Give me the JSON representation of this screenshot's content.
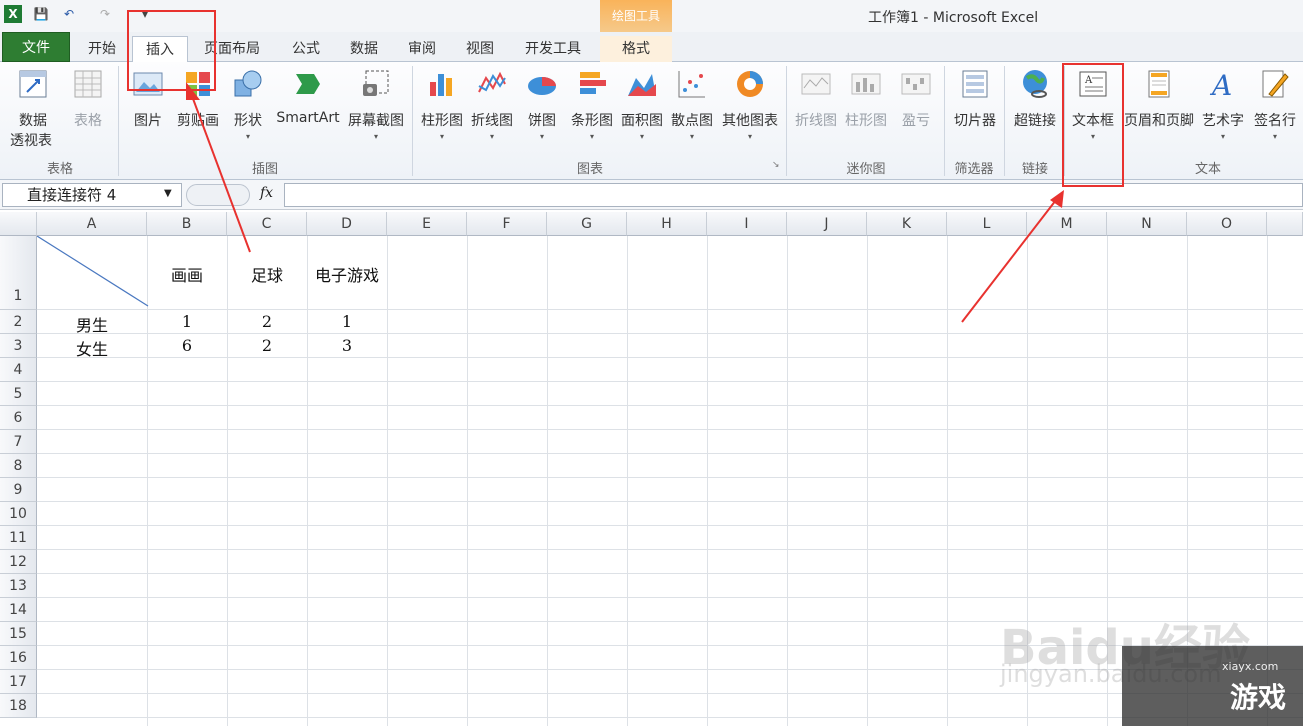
{
  "window": {
    "title": "工作簿1 - Microsoft Excel",
    "context_tab": "绘图工具"
  },
  "tabs": [
    {
      "label": "文件"
    },
    {
      "label": "开始"
    },
    {
      "label": "插入"
    },
    {
      "label": "页面布局"
    },
    {
      "label": "公式"
    },
    {
      "label": "数据"
    },
    {
      "label": "审阅"
    },
    {
      "label": "视图"
    },
    {
      "label": "开发工具"
    },
    {
      "label": "格式"
    }
  ],
  "ribbon": {
    "buttons": [
      {
        "label": "数据",
        "label2": "透视表",
        "icon": "pivot-table-icon"
      },
      {
        "label": "表格",
        "icon": "table-icon"
      },
      {
        "label": "图片",
        "icon": "picture-icon"
      },
      {
        "label": "剪贴画",
        "icon": "clipart-icon"
      },
      {
        "label": "形状",
        "icon": "shapes-icon"
      },
      {
        "label": "SmartArt",
        "icon": "smartart-icon"
      },
      {
        "label": "屏幕截图",
        "icon": "screenshot-icon"
      },
      {
        "label": "柱形图",
        "icon": "column-chart-icon"
      },
      {
        "label": "折线图",
        "icon": "line-chart-icon"
      },
      {
        "label": "饼图",
        "icon": "pie-chart-icon"
      },
      {
        "label": "条形图",
        "icon": "bar-chart-icon"
      },
      {
        "label": "面积图",
        "icon": "area-chart-icon"
      },
      {
        "label": "散点图",
        "icon": "scatter-chart-icon"
      },
      {
        "label": "其他图表",
        "icon": "other-charts-icon"
      },
      {
        "label": "折线图",
        "icon": "sparkline-line-icon"
      },
      {
        "label": "柱形图",
        "icon": "sparkline-column-icon"
      },
      {
        "label": "盈亏",
        "icon": "sparkline-winloss-icon"
      },
      {
        "label": "切片器",
        "icon": "slicer-icon"
      },
      {
        "label": "超链接",
        "icon": "hyperlink-icon"
      },
      {
        "label": "文本框",
        "icon": "textbox-icon"
      },
      {
        "label": "页眉和页脚",
        "icon": "header-footer-icon"
      },
      {
        "label": "艺术字",
        "icon": "wordart-icon"
      },
      {
        "label": "签名行",
        "icon": "signature-icon"
      }
    ],
    "groups": [
      "表格",
      "插图",
      "图表",
      "迷你图",
      "筛选器",
      "链接",
      "文本"
    ]
  },
  "formula_bar": {
    "name_box": "直接连接符 4",
    "fx": "fx",
    "value": ""
  },
  "sheet": {
    "columns": [
      "A",
      "B",
      "C",
      "D",
      "E",
      "F",
      "G",
      "H",
      "I",
      "J",
      "K",
      "L",
      "M",
      "N",
      "O"
    ],
    "rows": [
      "1",
      "2",
      "3",
      "4",
      "5",
      "6",
      "7",
      "8",
      "9",
      "10",
      "11",
      "12",
      "13",
      "14",
      "15",
      "16",
      "17",
      "18"
    ],
    "header_row": [
      "画画",
      "足球",
      "电子游戏"
    ],
    "data": [
      {
        "label": "男生",
        "values": [
          "1",
          "2",
          "1"
        ]
      },
      {
        "label": "女生",
        "values": [
          "6",
          "2",
          "3"
        ]
      }
    ]
  },
  "watermark": {
    "text": "Baidu经验",
    "sub": "jingyan.baidu.com",
    "logo_text": "游戏",
    "logo_sub": "xiayx.com"
  },
  "colors": {
    "file_tab": "#2e7d32",
    "annotation": "#e8322f",
    "context_tab": "#f9b35a"
  }
}
